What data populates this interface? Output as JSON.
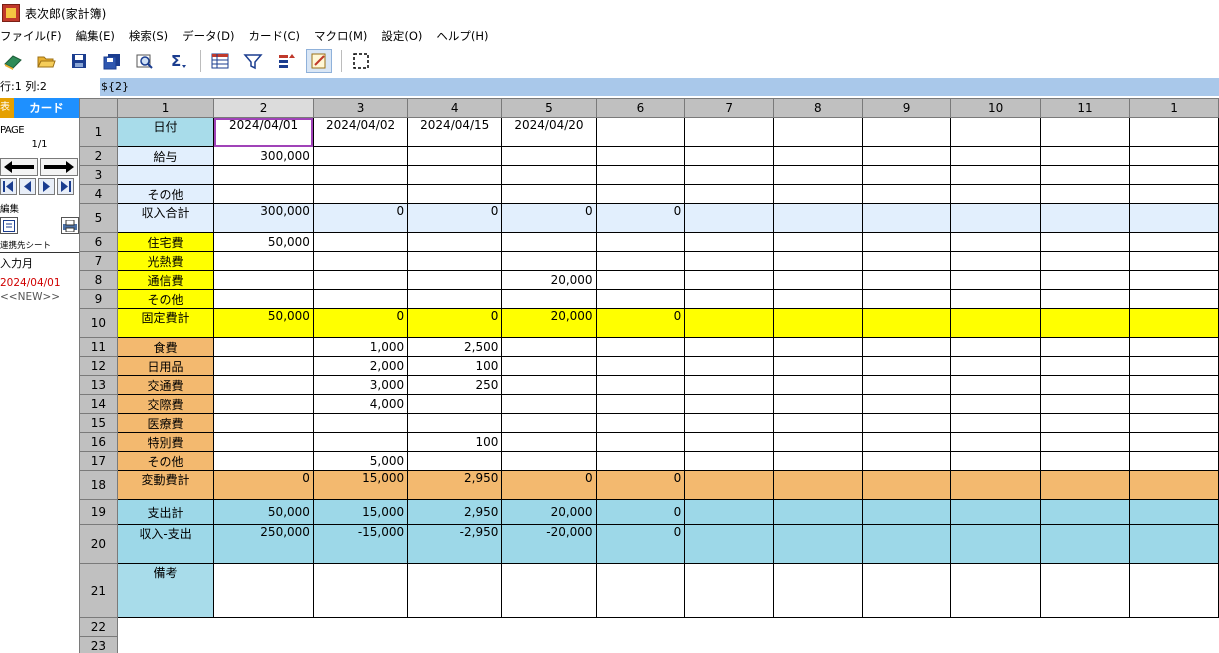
{
  "app": {
    "title": "表次郎(家計簿)"
  },
  "menu": [
    "ファイル(F)",
    "編集(E)",
    "検索(S)",
    "データ(D)",
    "カード(C)",
    "マクロ(M)",
    "設定(O)",
    "ヘルプ(H)"
  ],
  "toolbar": {
    "buttons": [
      {
        "icon": "book-icon",
        "color": "#2e8b57"
      },
      {
        "icon": "folder-open-icon",
        "color": "#e8b030"
      },
      {
        "icon": "save-icon",
        "color": "#1b3d8f"
      },
      {
        "icon": "save-as-icon",
        "color": "#1b3d8f"
      },
      {
        "icon": "print-preview-icon",
        "color": "#4a6fa5"
      },
      {
        "icon": "sum-icon",
        "color": "#1b3d8f"
      },
      {
        "icon": "grid-view-icon",
        "color": "#c0392b"
      },
      {
        "icon": "filter-icon",
        "color": "#1b3d8f"
      },
      {
        "icon": "sort-icon",
        "color": "#c0392b"
      },
      {
        "icon": "edit-note-icon",
        "color": "#e8b030"
      },
      {
        "icon": "select-range-icon",
        "color": "#000000"
      }
    ]
  },
  "status": {
    "position": "行:1 列:2",
    "formula": "${2}"
  },
  "card_panel": {
    "tab_record": "表記",
    "tab_card": "カード",
    "page_label": "PAGE",
    "page_value": "1/1",
    "edit_label": "編集",
    "link_label": "連携先シート",
    "link_value": "入力月",
    "record_date": "2024/04/01",
    "record_new": "<<NEW>>"
  },
  "grid": {
    "col_headers": [
      "1",
      "2",
      "3",
      "4",
      "5",
      "6",
      "7",
      "8",
      "9",
      "10",
      "11",
      "1"
    ],
    "selected_col": 1,
    "rows": [
      {
        "n": "1",
        "label": "日付",
        "style": "head",
        "tall": true,
        "cells": [
          "2024/04/01",
          "2024/04/02",
          "2024/04/15",
          "2024/04/20",
          "",
          "",
          "",
          "",
          "",
          ""
        ]
      },
      {
        "n": "2",
        "label": "給与",
        "style": "light",
        "cells": [
          "300,000",
          "",
          "",
          "",
          "",
          "",
          "",
          "",
          "",
          ""
        ]
      },
      {
        "n": "3",
        "label": "",
        "style": "light",
        "cells": [
          "",
          "",
          "",
          "",
          "",
          "",
          "",
          "",
          "",
          ""
        ]
      },
      {
        "n": "4",
        "label": "その他",
        "style": "light",
        "cells": [
          "",
          "",
          "",
          "",
          "",
          "",
          "",
          "",
          "",
          ""
        ]
      },
      {
        "n": "5",
        "label": "収入合計",
        "style": "light",
        "total": true,
        "tall": true,
        "cells": [
          "300,000",
          "0",
          "0",
          "0",
          "0",
          "",
          "",
          "",
          "",
          ""
        ]
      },
      {
        "n": "6",
        "label": "住宅費",
        "style": "yellow",
        "cells": [
          "50,000",
          "",
          "",
          "",
          "",
          "",
          "",
          "",
          "",
          ""
        ]
      },
      {
        "n": "7",
        "label": "光熱費",
        "style": "yellow",
        "cells": [
          "",
          "",
          "",
          "",
          "",
          "",
          "",
          "",
          "",
          ""
        ]
      },
      {
        "n": "8",
        "label": "通信費",
        "style": "yellow",
        "cells": [
          "",
          "",
          "",
          "20,000",
          "",
          "",
          "",
          "",
          "",
          ""
        ]
      },
      {
        "n": "9",
        "label": "その他",
        "style": "yellow",
        "cells": [
          "",
          "",
          "",
          "",
          "",
          "",
          "",
          "",
          "",
          ""
        ]
      },
      {
        "n": "10",
        "label": "固定費計",
        "style": "yellow",
        "total": true,
        "tall": true,
        "cells": [
          "50,000",
          "0",
          "0",
          "20,000",
          "0",
          "",
          "",
          "",
          "",
          ""
        ]
      },
      {
        "n": "11",
        "label": "食費",
        "style": "orange",
        "cells": [
          "",
          "1,000",
          "2,500",
          "",
          "",
          "",
          "",
          "",
          "",
          ""
        ]
      },
      {
        "n": "12",
        "label": "日用品",
        "style": "orange",
        "cells": [
          "",
          "2,000",
          "100",
          "",
          "",
          "",
          "",
          "",
          "",
          ""
        ]
      },
      {
        "n": "13",
        "label": "交通費",
        "style": "orange",
        "cells": [
          "",
          "3,000",
          "250",
          "",
          "",
          "",
          "",
          "",
          "",
          ""
        ]
      },
      {
        "n": "14",
        "label": "交際費",
        "style": "orange",
        "cells": [
          "",
          "4,000",
          "",
          "",
          "",
          "",
          "",
          "",
          "",
          ""
        ]
      },
      {
        "n": "15",
        "label": "医療費",
        "style": "orange",
        "cells": [
          "",
          "",
          "",
          "",
          "",
          "",
          "",
          "",
          "",
          ""
        ]
      },
      {
        "n": "16",
        "label": "特別費",
        "style": "orange",
        "cells": [
          "",
          "",
          "100",
          "",
          "",
          "",
          "",
          "",
          "",
          ""
        ]
      },
      {
        "n": "17",
        "label": "その他",
        "style": "orange",
        "cells": [
          "",
          "5,000",
          "",
          "",
          "",
          "",
          "",
          "",
          "",
          ""
        ]
      },
      {
        "n": "18",
        "label": "変動費計",
        "style": "orange",
        "total": true,
        "tall": true,
        "cells": [
          "0",
          "15,000",
          "2,950",
          "0",
          "0",
          "",
          "",
          "",
          "",
          ""
        ]
      },
      {
        "n": "19",
        "label": "支出計",
        "style": "blue",
        "total": true,
        "mid": true,
        "cells": [
          "50,000",
          "15,000",
          "2,950",
          "20,000",
          "0",
          "",
          "",
          "",
          "",
          ""
        ]
      },
      {
        "n": "20",
        "label": "収入-支出",
        "style": "blue",
        "total": true,
        "big": true,
        "cells": [
          "250,000",
          "-15,000",
          "-2,950",
          "-20,000",
          "0",
          "",
          "",
          "",
          "",
          ""
        ]
      },
      {
        "n": "21",
        "label": "備考",
        "style": "memo",
        "huge": true,
        "cells": [
          "",
          "",
          "",
          "",
          "",
          "",
          "",
          "",
          "",
          ""
        ]
      },
      {
        "n": "22",
        "label": "",
        "style": "none",
        "cells": []
      },
      {
        "n": "23",
        "label": "",
        "style": "none",
        "cells": []
      }
    ]
  },
  "colors": {
    "header_gray": "#c0c0c0",
    "light_blue": "#e2effd",
    "yellow": "#ffff00",
    "orange": "#f3b96f",
    "cyan": "#9dd8e8",
    "formula_bar": "#a9c8ea",
    "card_tab": "#1e90ff",
    "record_date": "#d00000",
    "current_cell": "#a043b8"
  }
}
